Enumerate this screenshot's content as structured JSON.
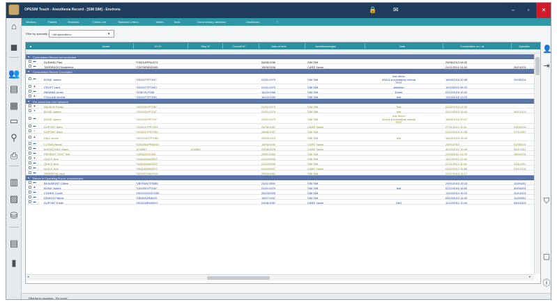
{
  "window": {
    "title": "OPESIM Touch - Anesthesia Record - [SIM SIM] - Environs",
    "controls": {
      "minimize": "–",
      "maximize": "▫",
      "close": "✕"
    }
  },
  "menu": [
    {
      "label": "Window"
    },
    {
      "label": "Patient"
    },
    {
      "label": "Worklists"
    },
    {
      "label": "Check-List"
    },
    {
      "label": "Standard Letters"
    },
    {
      "label": "Tables"
    },
    {
      "label": "Tools"
    },
    {
      "label": "Documentary database"
    },
    {
      "label": "Dashboard"
    },
    {
      "label": "?"
    }
  ],
  "filter": {
    "label": "Filter by specialty :",
    "value": "<All specialties>"
  },
  "grid": {
    "columns": [
      {
        "label": "Name"
      },
      {
        "label": "N.I.R."
      },
      {
        "label": "Stay N°"
      },
      {
        "label": "Consult N°"
      },
      {
        "label": "Date of birth"
      },
      {
        "label": "Anesthesiologist"
      },
      {
        "label": "Note"
      },
      {
        "label": "Consultation on / at"
      },
      {
        "label": "Operatio"
      }
    ],
    "groups": [
      {
        "title": "Consultation Record not concluded",
        "rows": [
          {
            "icon": "male",
            "name": "DURAND Paul",
            "nir": "*150DURPAU073",
            "stay": "",
            "consult": "",
            "dob": "05/08/1936",
            "anes": "SIM SIM",
            "note": "",
            "date": "25/08/2013 08:30",
            "op": "",
            "color": "black"
          },
          {
            "icon": "male",
            "name": "TARDENOIS Madeleine",
            "nir": "*230TARMAD048",
            "stay": "",
            "consult": "",
            "dob": "18/06/1938",
            "anes": "CARE Xavier",
            "note": "",
            "date": "24/11/2014 14:48",
            "op": "26/10/201",
            "color": "black"
          }
        ]
      },
      {
        "title": "Consultation Record Concluded",
        "rows": [
          {
            "icon": "male",
            "name": "BOND James",
            "nir": "*1DOOTYP7047",
            "stay": "",
            "consult": "",
            "dob": "01/01/1970",
            "anes": "SIM SIM",
            "note": "test demo\nASA is a mandatory criteria\nTEST",
            "date": "16/04/2016 02:28",
            "op": "02/05/201",
            "color": "blue",
            "tall": true
          },
          {
            "icon": "car",
            "name": "CROFT Lara",
            "nir": "*1DOOTYP7040",
            "stay": "",
            "consult": "",
            "dob": "01/01/1970",
            "anes": "SIM SIM",
            "note": "attention",
            "date": "11/02/2015 09:53",
            "op": "",
            "color": "blue"
          },
          {
            "icon": "male",
            "name": "INDIANA Jones",
            "nir": "*1DBY2U7055",
            "stay": "",
            "consult": "",
            "dob": "16/10/1966",
            "anes": "SIM SIM",
            "note": "Exam",
            "date": "02/12/2015 15:32",
            "op": "",
            "color": "blue"
          },
          {
            "icon": "car",
            "name": "POULAIN Amélie",
            "nir": "*1DOOTYP7045",
            "stay": "",
            "consult": "",
            "dob": "16/10/1994",
            "anes": "SIM SIM",
            "note": "test",
            "date": "13/10/2015 13:15",
            "op": "",
            "color": "blue"
          }
        ]
      },
      {
        "title": "Pre-anesthetic visit validated",
        "rows": [
          {
            "icon": "car",
            "name": "BALBOA Rocky",
            "nir": "*1DOODYP7087",
            "stay": "",
            "consult": "",
            "dob": "01/01/1970",
            "anes": "SIM SIM",
            "note": "Test",
            "date": "21/02/2014 14:09",
            "op": "",
            "color": "olive"
          },
          {
            "icon": "person",
            "name": "BOND James",
            "nir": "*1DOODYP7047",
            "stay": "",
            "consult": "",
            "dob": "01/01/1970",
            "anes": "SIM SIM",
            "note": "test",
            "date": "02/12/2015 15:43",
            "op": "16/12/201",
            "color": "olive"
          },
          {
            "icon": "male",
            "name": "BOND James",
            "nir": "*1DOODYP7047",
            "stay": "",
            "consult": "",
            "dob": "01/01/1970",
            "anes": "SIM SIM",
            "note": "test demo\nASA is a mandatory criteria\nTEST",
            "date": "15/04/2016 09:17",
            "op": "",
            "color": "olive",
            "tall": true
          },
          {
            "icon": "male",
            "name": "DUPONT Marc",
            "nir": "*1DDO17PR7093",
            "stay": "",
            "consult": "",
            "dob": "24/08/1967",
            "anes": "CARE Xavier",
            "note": "",
            "date": "07/11/2012 11:42",
            "op": "23/04/201",
            "color": "olive"
          },
          {
            "icon": "yellow",
            "name": "DUPONT Marc",
            "nir": "*1DDO17PR7093",
            "stay": "",
            "consult": "",
            "dob": "24/08/1967",
            "anes": "SIM SIM",
            "note": "",
            "date": "01/12/2015 10:38",
            "op": "07/11/201",
            "color": "olive"
          },
          {
            "icon": "car",
            "name": "HALL Annie",
            "nir": "*1DOO1DYP7051",
            "stay": "",
            "consult": "",
            "dob": "25/03/1974",
            "anes": "SIM SIM",
            "note": "test",
            "date": "18/10/2015 15:03",
            "op": "",
            "color": "olive",
            "mid": true
          },
          {
            "icon": "male",
            "name": "LUTAIN Nicole",
            "nir": "*23SDSUPRI0044",
            "stay": "",
            "consult": "",
            "dob": "18/06/1940",
            "anes": "CARE Xavier",
            "note": "",
            "date": "25/01/2015",
            "op": "01/05/201",
            "color": "olive"
          },
          {
            "icon": "male",
            "name": "MARSCHALL Marie",
            "nir": "1234567",
            "stay": "1234567",
            "consult": "",
            "dob": "23/08/1978",
            "anes": "CARE Xavier",
            "note": "",
            "date": "30/10/2012 15:46",
            "op": "06/11/201",
            "color": "olive"
          },
          {
            "icon": "male",
            "name": "PROEDIT TEST Test",
            "nir": "*10RQZ12X003",
            "stay": "",
            "consult": "",
            "dob": "29/01/1964",
            "anes": "SIM SIM",
            "note": "",
            "date": "25/04/2011 12:09",
            "op": "28/04/201",
            "color": "olive"
          },
          {
            "icon": "red",
            "name": "QUICK Ana",
            "nir": "*16QUIDANZ037",
            "stay": "",
            "consult": "",
            "dob": "01/03/2005",
            "anes": "SIM SIM",
            "note": "",
            "date": "14/12/2012 12:40",
            "op": "",
            "color": "olive"
          },
          {
            "icon": "male",
            "name": "QUICK Ana",
            "nir": "*16QUIDANZ037",
            "stay": "",
            "consult": "",
            "dob": "01/03/2005",
            "anes": "SIM SIM",
            "note": "",
            "date": "21/11/2012 11:08",
            "op": "23/11/201",
            "color": "olive"
          },
          {
            "icon": "male",
            "name": "QUICK Ana",
            "nir": "*16QUIDANZ037",
            "stay": "",
            "consult": "",
            "dob": "01/03/2007",
            "anes": "CARE Xavier",
            "note": "",
            "date": "03/12/2012 16:58",
            "op": "03/12/201",
            "color": "olive"
          },
          {
            "icon": "male",
            "name": "SPARROW Jack",
            "nir": "*1D2OOYAN7041",
            "stay": "",
            "consult": "",
            "dob": "29/04/1961",
            "anes": "SIM SIM",
            "note": "",
            "date": "01/07/2014 14:17",
            "op": "",
            "color": "olive"
          }
        ]
      },
      {
        "title": "Return to Operating Room, unscheduled",
        "rows": [
          {
            "icon": "male",
            "name": "BEAUMONT Cäline",
            "nir": "*2BTRAN7TR085",
            "stay": "",
            "consult": "",
            "dob": "24/11/1939",
            "anes": "SIM SIM",
            "note": "",
            "date": "23/01/2015 15:16",
            "op": "11/09/201",
            "color": "blue"
          },
          {
            "icon": "car",
            "name": "BOND James",
            "nir": "*1DOODYP7047",
            "stay": "",
            "consult": "",
            "dob": "01/01/1970",
            "anes": "SIM SIM",
            "note": "test",
            "date": "02/12/2015 16:52",
            "op": "30/03/201",
            "color": "blue"
          },
          {
            "icon": "male",
            "name": "COHEN Cécile",
            "nir": "*2DOOOOC07059",
            "stay": "",
            "consult": "",
            "dob": "26/03/2009",
            "anes": "SIM SIM",
            "note": "",
            "date": "13/10/2014 15:10",
            "op": "20/10/201",
            "color": "blue"
          },
          {
            "icon": "male",
            "name": "DEWOS Patrick",
            "nir": "*1BDEADRA029",
            "stay": "",
            "consult": "",
            "dob": "16/07/1937",
            "anes": "SIM SIM",
            "note": "",
            "date": "06/10/2014 14:30",
            "op": "11/09/201",
            "color": "blue"
          },
          {
            "icon": "male",
            "name": "DUPONT Emile",
            "nir": "*2DDUMEMI0007",
            "stay": "",
            "consult": "",
            "dob": "03/06/1957",
            "anes": "CARE Xavier",
            "note": "SAS",
            "date": "12/12/2012 10:34",
            "op": "06/10/201",
            "color": "blue"
          }
        ]
      }
    ]
  },
  "status": {
    "text": "Filtering in progress : 'En cours'"
  },
  "colors": {
    "title_bar": "#1f3c5a",
    "menu_bar": "#2f98a6",
    "grid_header": "#2a8fa0",
    "group_band": "#5b74a9",
    "close": "#d11b2b"
  }
}
